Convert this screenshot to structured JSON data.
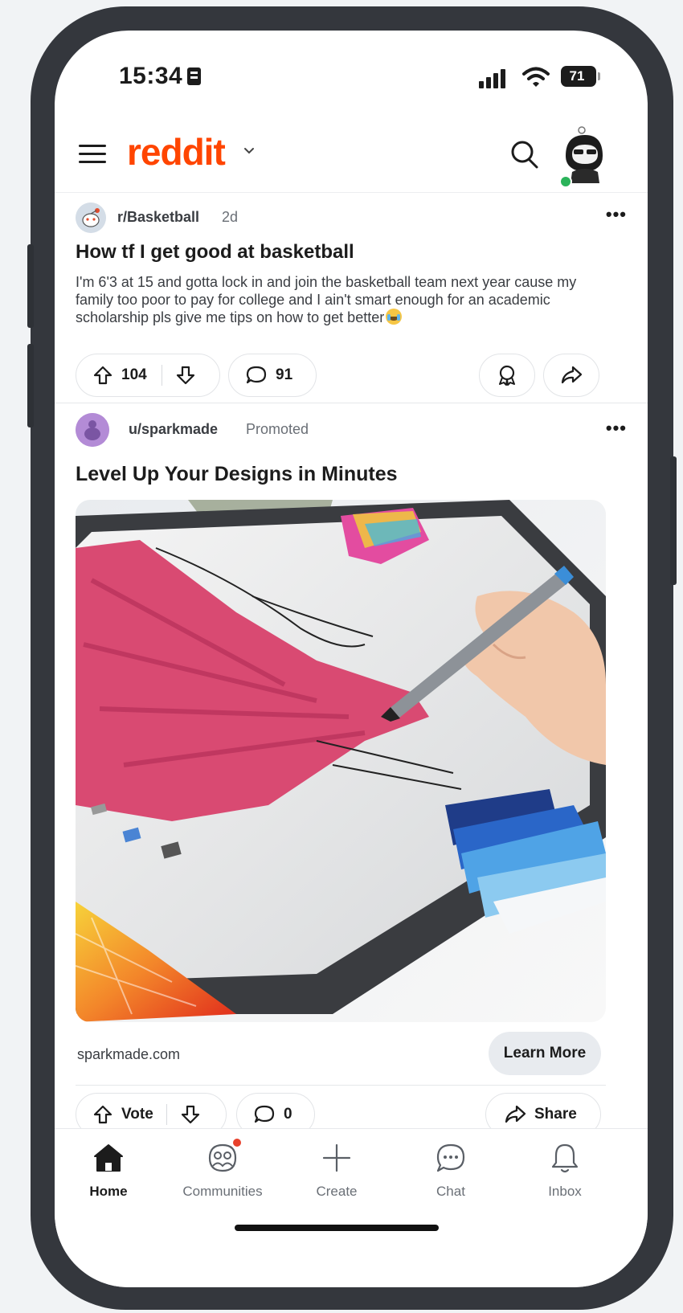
{
  "status_bar": {
    "time": "15:34",
    "battery": "71"
  },
  "header": {
    "brand": "reddit"
  },
  "post1": {
    "subreddit": "r/Basketball",
    "age": "2d",
    "title": "How tf I get good at basketball",
    "body": "I'm 6'3 at 15 and gotta lock in and join the basketball team next year cause my family too poor to pay for college and I ain't smart enough for an academic scholarship pls give me tips on how to get better",
    "votes": "104",
    "comments": "91"
  },
  "post2": {
    "user": "u/sparkmade",
    "promoted_label": "Promoted",
    "title": "Level Up Your Designs in Minutes",
    "domain": "sparkmade.com",
    "cta": "Learn More",
    "vote_label": "Vote",
    "comments": "0",
    "share_label": "Share"
  },
  "bottom_nav": {
    "items": [
      {
        "label": "Home",
        "icon": "home-icon",
        "active": true
      },
      {
        "label": "Communities",
        "icon": "communities-icon",
        "active": false
      },
      {
        "label": "Create",
        "icon": "plus-icon",
        "active": false
      },
      {
        "label": "Chat",
        "icon": "chat-icon",
        "active": false
      },
      {
        "label": "Inbox",
        "icon": "bell-icon",
        "active": false
      }
    ]
  },
  "colors": {
    "brand": "#ff4500",
    "text": "#1c1c1c",
    "muted": "#6a6f76",
    "online": "#2bb35a",
    "notification": "#e8412c"
  }
}
